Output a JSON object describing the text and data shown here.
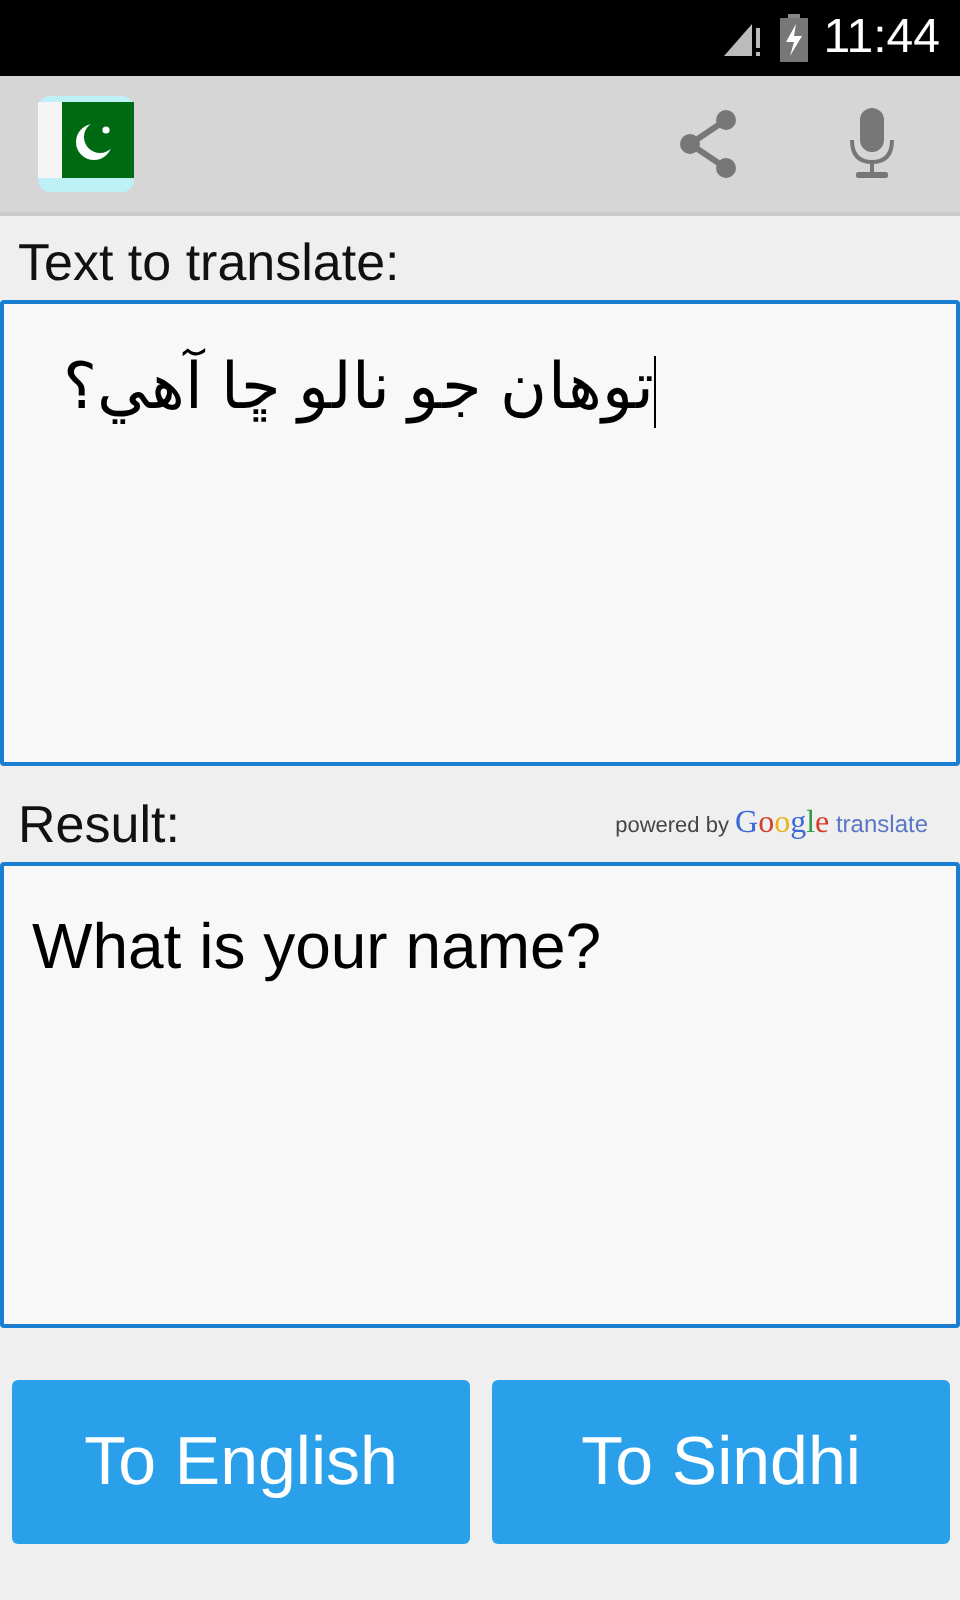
{
  "status_bar": {
    "time": "11:44"
  },
  "source": {
    "label": "Text to translate:",
    "value": "توهان جو نالو ڇا آهي؟",
    "focused": true
  },
  "result": {
    "label": "Result:",
    "attribution": {
      "prefix": "powered by",
      "brand": "Google",
      "suffix": "translate"
    },
    "value": "What is your name?"
  },
  "buttons": [
    {
      "label": "To English"
    },
    {
      "label": "To Sindhi"
    }
  ]
}
